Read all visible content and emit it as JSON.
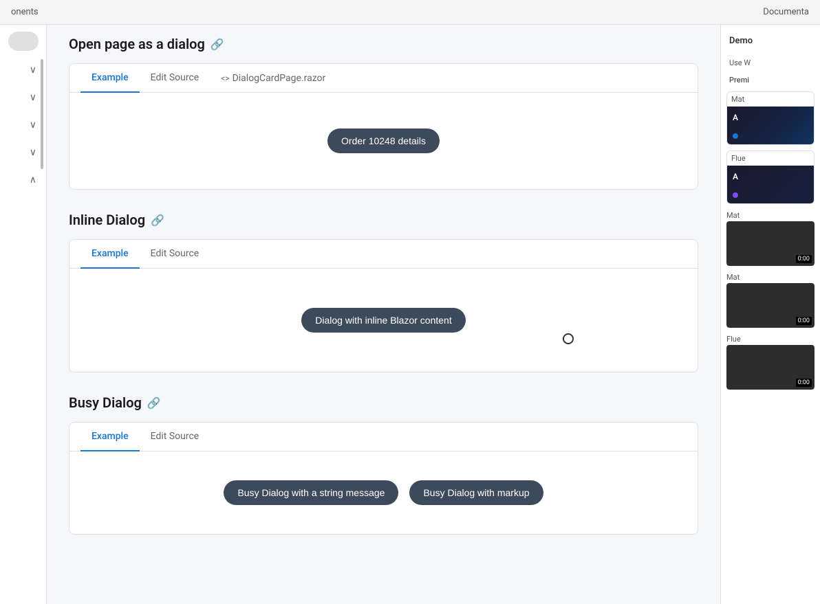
{
  "topbar": {
    "left_text": "onents",
    "right_text": "Documenta"
  },
  "sidebar": {
    "items": [
      {
        "label": "chevron-down",
        "expanded": true
      },
      {
        "label": "chevron-down",
        "expanded": true
      },
      {
        "label": "chevron-down",
        "expanded": true
      },
      {
        "label": "chevron-down",
        "expanded": true
      },
      {
        "label": "chevron-up",
        "expanded": false
      }
    ]
  },
  "sections": [
    {
      "id": "open-page-dialog",
      "title": "Open page as a dialog",
      "tabs": [
        "Example",
        "Edit Source"
      ],
      "source_file": "DialogCardPage.razor",
      "active_tab": "Example",
      "content_type": "single_button",
      "button_label": "Order 10248 details"
    },
    {
      "id": "inline-dialog",
      "title": "Inline Dialog",
      "tabs": [
        "Example",
        "Edit Source"
      ],
      "active_tab": "Example",
      "content_type": "single_button",
      "button_label": "Dialog with inline Blazor content"
    },
    {
      "id": "busy-dialog",
      "title": "Busy Dialog",
      "tabs": [
        "Example",
        "Edit Source"
      ],
      "active_tab": "Example",
      "content_type": "two_buttons",
      "button1_label": "Busy Dialog with a string message",
      "button2_label": "Busy Dialog with markup"
    }
  ],
  "right_panel": {
    "header": "Demo",
    "items": [
      {
        "type": "promo_text",
        "label": "Use W",
        "style": "text"
      },
      {
        "type": "promo_header",
        "label": "Premi",
        "style": "header"
      },
      {
        "type": "promo_card",
        "label": "Mat",
        "subtitle": "A",
        "accent": "#1976d2",
        "style": "dark"
      },
      {
        "type": "promo_card",
        "label": "Flue",
        "subtitle": "A",
        "accent": "#7c4dff",
        "style": "dark"
      },
      {
        "type": "thumbnail",
        "label": "Mat",
        "style": "video"
      },
      {
        "type": "thumbnail",
        "label": "Mat",
        "style": "video"
      },
      {
        "type": "thumbnail",
        "label": "Flue",
        "style": "video"
      }
    ]
  }
}
